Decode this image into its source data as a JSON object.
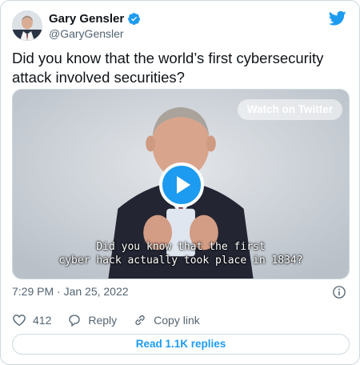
{
  "author": {
    "name": "Gary Gensler",
    "handle": "@GaryGensler"
  },
  "tweet": {
    "text_line1": "Did you know that the world’s first cybersecurity",
    "text_line2": "attack involved securities?"
  },
  "media": {
    "watch_label": "Watch on Twitter",
    "caption_line1": "Did you know that the first",
    "caption_line2": "cyber hack actually took place in 1834?"
  },
  "meta": {
    "timestamp": "7:29 PM · Jan 25, 2022"
  },
  "actions": {
    "like_count": "412",
    "reply_label": "Reply",
    "copy_label": "Copy link"
  },
  "read_replies_label": "Read 1.1K replies",
  "colors": {
    "accent": "#1d9bf0",
    "text": "#0f1419",
    "secondary": "#536471",
    "border": "#cfd9de"
  },
  "icons": [
    "verified-badge-icon",
    "twitter-bird-icon",
    "play-icon",
    "info-icon",
    "heart-icon",
    "reply-icon",
    "link-icon"
  ]
}
